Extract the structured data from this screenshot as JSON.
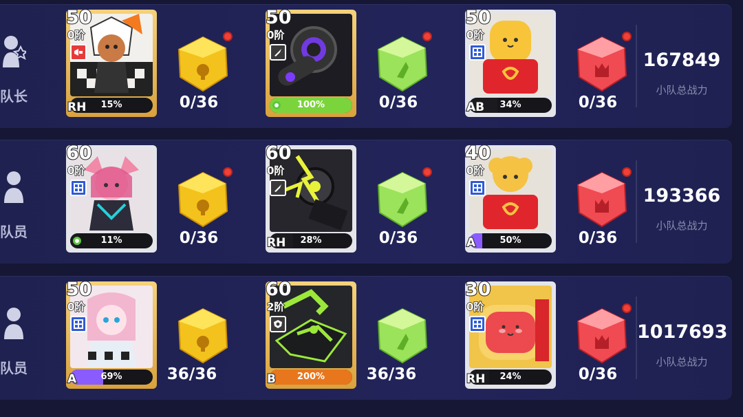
{
  "power_label": "小队总战力",
  "rows": [
    {
      "role_label": "队长",
      "role_icon": "star-person-icon",
      "total_power": "167849",
      "slots": [
        {
          "level": "50",
          "stage": "0阶",
          "element_icon": "megaphone-icon",
          "element_color": "#e63b3b",
          "progress": 15,
          "progress_text": "15%",
          "rank": "RH",
          "bar_color": "#1a1a1f",
          "frame": "gold",
          "portrait": "white-hair-girl",
          "crystal": "yellow",
          "count": "0/36"
        },
        {
          "level": "50",
          "stage": "0阶",
          "element_icon": "rocket-icon",
          "element_color": "#3a3a3a",
          "progress": 100,
          "progress_text": "100%",
          "rank": "",
          "bar_color": "#7bd43c",
          "frame": "gold",
          "portrait": "dark-device",
          "crystal": "green",
          "count": "0/36"
        },
        {
          "level": "50",
          "stage": "0阶",
          "element_icon": "grid-icon",
          "element_color": "#2f5bd6",
          "progress": 34,
          "progress_text": "34%",
          "rank": "AB",
          "bar_color": "#1a1a1f",
          "frame": "silver",
          "portrait": "fries-mascot",
          "crystal": "red",
          "count": "0/36"
        }
      ]
    },
    {
      "role_label": "队员",
      "role_icon": "person-icon",
      "total_power": "193366",
      "slots": [
        {
          "level": "60",
          "stage": "0阶",
          "element_icon": "grid-icon",
          "element_color": "#2f5bd6",
          "progress": 11,
          "progress_text": "11%",
          "rank": "",
          "bar_color": "#1a1a1f",
          "frame": "silver",
          "portrait": "pink-cat-girl",
          "crystal": "yellow",
          "count": "0/36"
        },
        {
          "level": "60",
          "stage": "0阶",
          "element_icon": "rocket-icon",
          "element_color": "#3a3a3a",
          "progress": 28,
          "progress_text": "28%",
          "rank": "RH",
          "bar_color": "#1a1a1f",
          "frame": "silver",
          "portrait": "lightning-mech",
          "crystal": "green",
          "count": "0/36"
        },
        {
          "level": "40",
          "stage": "0阶",
          "element_icon": "grid-icon",
          "element_color": "#2f5bd6",
          "progress": 50,
          "progress_text": "50%",
          "rank": "A",
          "bar_color": "#8a5cff",
          "frame": "silver",
          "portrait": "popcorn-mascot",
          "crystal": "red",
          "count": "0/36"
        }
      ]
    },
    {
      "role_label": "队员",
      "role_icon": "person-icon",
      "total_power": "1017693",
      "slots": [
        {
          "level": "50",
          "stage": "0阶",
          "element_icon": "grid-icon",
          "element_color": "#2f5bd6",
          "progress": 69,
          "progress_text": "69%",
          "rank": "A",
          "bar_color": "#8a5cff",
          "frame": "gold",
          "portrait": "pink-bunny-girl",
          "crystal": "yellow",
          "count": "36/36"
        },
        {
          "level": "60",
          "stage": "2阶",
          "element_icon": "shield-icon",
          "element_color": "#3a3a3a",
          "progress": 200,
          "progress_text": "200%",
          "rank": "B",
          "bar_color": "#e8761d",
          "frame": "gold",
          "portrait": "green-mech",
          "crystal": "green",
          "count": "36/36"
        },
        {
          "level": "30",
          "stage": "0阶",
          "element_icon": "grid-icon",
          "element_color": "#2f5bd6",
          "progress": 24,
          "progress_text": "24%",
          "rank": "RH",
          "bar_color": "#1a1a1f",
          "frame": "silver",
          "portrait": "ham-mascot",
          "crystal": "red",
          "count": "0/36"
        }
      ]
    }
  ]
}
